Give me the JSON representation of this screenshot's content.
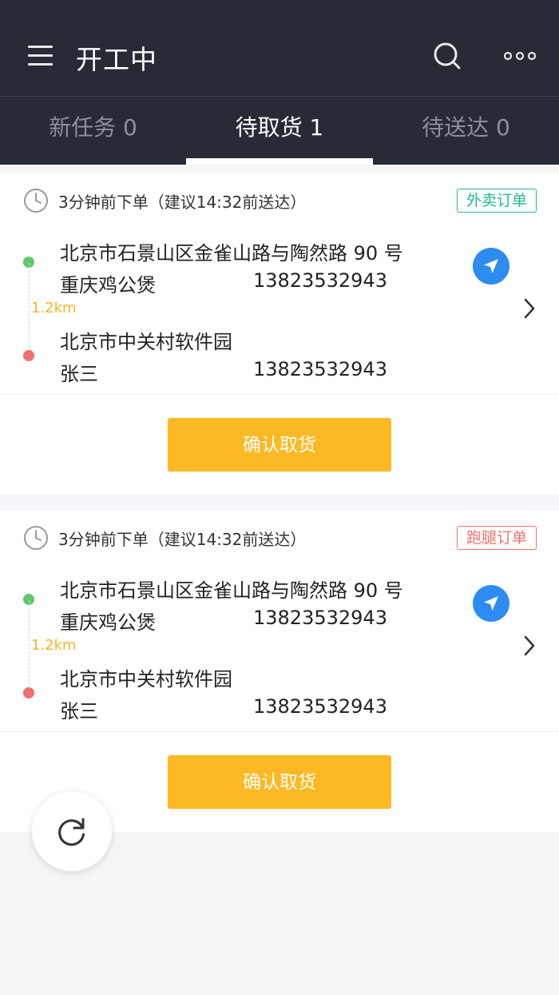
{
  "header": {
    "title": "开工中",
    "menu_icon": "hamburger-menu-icon",
    "search_icon": "search-icon",
    "more_icon": "more-dots-icon",
    "background_color": "#262b36"
  },
  "tabs": [
    {
      "label": "新任务 0",
      "active": false
    },
    {
      "label": "待取货 1",
      "active": true
    },
    {
      "label": "待送达 0",
      "active": false
    }
  ],
  "orders": [
    {
      "time_text": "3分钟前下单（建议14:32前送达）",
      "tag": "外卖订单",
      "tag_color": "#1fb89a",
      "pickup": {
        "address": "北京市石景山区金雀山路与陶然路 90 号",
        "name": "重庆鸡公煲",
        "phone": "13823532943"
      },
      "distance": "1.2km",
      "dropoff": {
        "address": "北京市中关村软件园",
        "name": "张三",
        "phone": "13823532943"
      },
      "action_label": "确认取货"
    },
    {
      "time_text": "3分钟前下单（建议14:32前送达）",
      "tag": "跑腿订单",
      "tag_color": "#f07270",
      "pickup": {
        "address": "北京市石景山区金雀山路与陶然路 90 号",
        "name": "重庆鸡公煲",
        "phone": "13823532943"
      },
      "distance": "1.2km",
      "dropoff": {
        "address": "北京市中关村软件园",
        "name": "张三",
        "phone": "13823532943"
      },
      "action_label": "确认取货"
    }
  ],
  "colors": {
    "accent_yellow": "#fdb924",
    "navigation_blue": "#2c8cf0",
    "pickup_dot": "#5ec96b",
    "dropoff_dot": "#f07270"
  },
  "fab": {
    "icon": "refresh-icon"
  }
}
